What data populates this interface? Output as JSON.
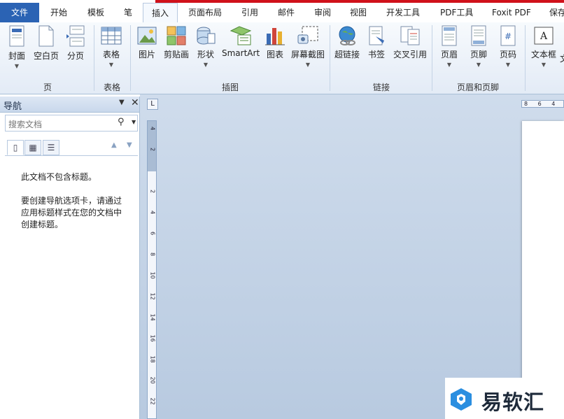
{
  "tabs": [
    "文件",
    "开始",
    "模板",
    "笔",
    "插入",
    "页面布局",
    "引用",
    "邮件",
    "审阅",
    "视图",
    "开发工具",
    "PDF工具",
    "Foxit PDF",
    "保存"
  ],
  "active_tab": "插入",
  "ribbon": {
    "buttons": {
      "cover": "封面",
      "blank_page": "空白页",
      "page_break": "分页",
      "table": "表格",
      "picture": "图片",
      "clipart": "剪贴画",
      "shapes": "形状",
      "smartart": "SmartArt",
      "chart": "图表",
      "screenshot": "屏幕截图",
      "hyperlink": "超链接",
      "bookmark": "书签",
      "cross_ref": "交叉引用",
      "header": "页眉",
      "footer": "页脚",
      "page_number": "页码",
      "textbox": "文本框",
      "more": "文"
    },
    "groups": {
      "pages": "页",
      "tables": "表格",
      "illustrations": "插图",
      "links": "链接",
      "header_footer": "页眉和页脚"
    }
  },
  "nav": {
    "title": "导航",
    "search_placeholder": "搜索文档",
    "line1": "此文档不包含标题。",
    "line2": "要创建导航选项卡，请通过",
    "line3": "应用标题样式在您的文档中",
    "line4": "创建标题。"
  },
  "ruler": {
    "corner": "L",
    "h_ticks": "8 6 4",
    "v_ticks": [
      "4",
      "2",
      "2",
      "4",
      "6",
      "8",
      "10",
      "12",
      "14",
      "16",
      "18",
      "20",
      "22"
    ]
  },
  "watermark": {
    "text": "易软汇"
  },
  "colors": {
    "file_tab": "#2b63b4",
    "accent_red": "#d0111a"
  }
}
